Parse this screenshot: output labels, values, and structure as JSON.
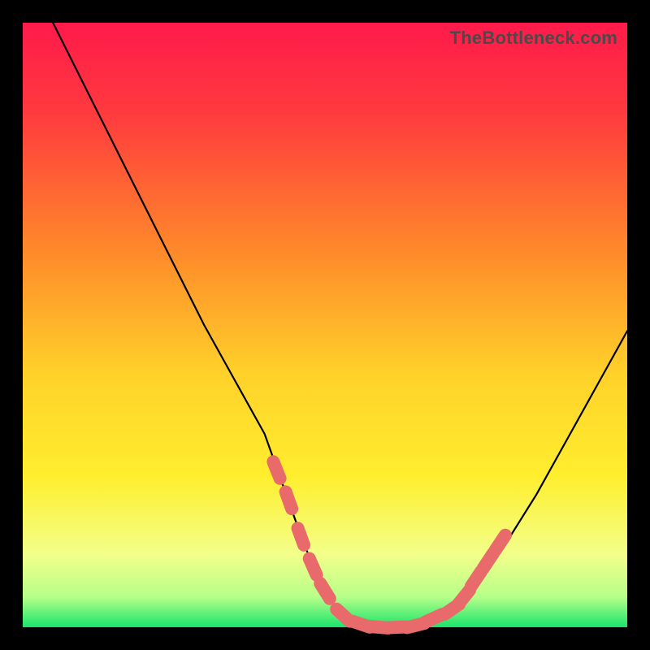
{
  "watermark": "TheBottleneck.com",
  "colors": {
    "frame": "#000000",
    "gradient_top": "#ff1a4b",
    "gradient_mid_orange": "#ff9e2a",
    "gradient_yellow": "#ffe92e",
    "gradient_pale": "#f6ff9e",
    "gradient_green": "#19e46b",
    "curve": "#000000",
    "marker": "#e86a6a"
  },
  "chart_data": {
    "type": "line",
    "title": "",
    "xlabel": "",
    "ylabel": "",
    "xlim": [
      0,
      100
    ],
    "ylim": [
      0,
      100
    ],
    "grid": false,
    "curve": {
      "name": "bottleneck-curve",
      "x": [
        5,
        10,
        15,
        20,
        25,
        30,
        35,
        40,
        45,
        48,
        50,
        52,
        55,
        58,
        60,
        62,
        65,
        70,
        75,
        80,
        85,
        90,
        95,
        100
      ],
      "y": [
        100,
        90,
        80,
        70,
        60,
        50,
        41,
        32,
        18,
        10,
        6,
        3,
        1,
        0,
        0,
        0,
        0,
        2,
        7,
        14,
        22,
        31,
        40,
        49
      ]
    },
    "markers": {
      "name": "highlighted-range",
      "points": [
        {
          "x": 42,
          "y": 26
        },
        {
          "x": 44,
          "y": 21
        },
        {
          "x": 46,
          "y": 15
        },
        {
          "x": 48,
          "y": 10
        },
        {
          "x": 50,
          "y": 6
        },
        {
          "x": 53,
          "y": 2
        },
        {
          "x": 56,
          "y": 0.5
        },
        {
          "x": 59,
          "y": 0
        },
        {
          "x": 62,
          "y": 0
        },
        {
          "x": 65,
          "y": 0.3
        },
        {
          "x": 68,
          "y": 1.5
        },
        {
          "x": 71,
          "y": 3
        },
        {
          "x": 73,
          "y": 5
        },
        {
          "x": 75,
          "y": 8
        },
        {
          "x": 77,
          "y": 11
        },
        {
          "x": 79,
          "y": 14
        }
      ],
      "radius": 10
    },
    "gradient_stops": [
      {
        "pct": 0,
        "color": "#ff1a4b"
      },
      {
        "pct": 15,
        "color": "#ff3a3e"
      },
      {
        "pct": 38,
        "color": "#ff8a2a"
      },
      {
        "pct": 58,
        "color": "#ffd12a"
      },
      {
        "pct": 75,
        "color": "#ffee2e"
      },
      {
        "pct": 88,
        "color": "#f2ff8a"
      },
      {
        "pct": 95,
        "color": "#b6ff8a"
      },
      {
        "pct": 100,
        "color": "#19e46b"
      }
    ]
  }
}
